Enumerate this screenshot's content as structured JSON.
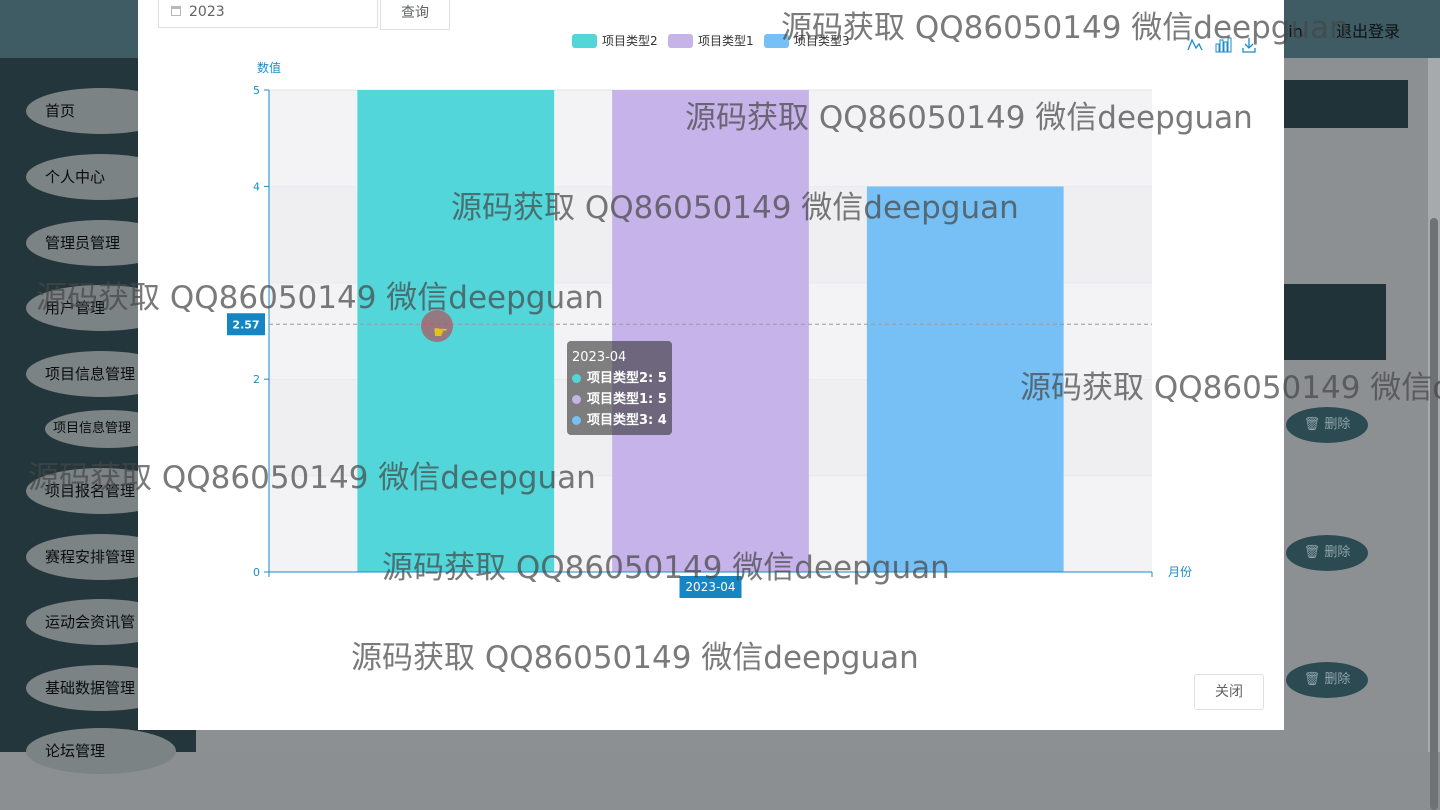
{
  "header": {
    "user_suffix": "in",
    "logout_label": "退出登录"
  },
  "sidebar": {
    "items": [
      {
        "label": "首页"
      },
      {
        "label": "个人中心"
      },
      {
        "label": "管理员管理"
      },
      {
        "label": "用户管理"
      },
      {
        "label": "项目信息管理"
      },
      {
        "label": "项目信息管理"
      },
      {
        "label": "项目报名管理"
      },
      {
        "label": "赛程安排管理"
      },
      {
        "label": "运动会资讯管"
      },
      {
        "label": "基础数据管理"
      },
      {
        "label": "论坛管理"
      }
    ]
  },
  "table": {
    "delete_label": "删除",
    "delete_icon": "trash-icon"
  },
  "modal": {
    "search_value": "2023",
    "query_label": "查询",
    "close_label": "关闭",
    "toolbox_icons": [
      "line-chart-icon",
      "bar-chart-icon",
      "download-icon"
    ]
  },
  "chart_data": {
    "type": "bar",
    "categories": [
      "2023-04"
    ],
    "series": [
      {
        "name": "项目类型2",
        "values": [
          5
        ],
        "color": "#52d6da"
      },
      {
        "name": "项目类型1",
        "values": [
          5
        ],
        "color": "#c6b3ea"
      },
      {
        "name": "项目类型3",
        "values": [
          4
        ],
        "color": "#76c0f5"
      }
    ],
    "ylabel": "数值",
    "xlabel": "月份",
    "ylim": [
      0,
      5
    ],
    "yticks": [
      "0",
      "2",
      "4",
      "5"
    ],
    "legend_position": "top-center",
    "axis_pointer_value": "2.57",
    "axis_pointer_category": "2023-04",
    "tooltip": {
      "title": "2023-04",
      "rows": [
        "项目类型2: 5",
        "项目类型1: 5",
        "项目类型3: 4"
      ]
    }
  },
  "watermark": "源码获取 QQ86050149 微信deepguan"
}
